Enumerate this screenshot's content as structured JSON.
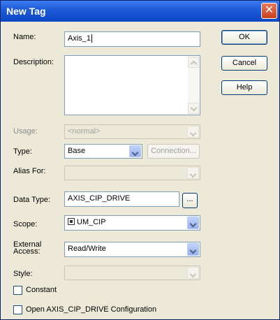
{
  "window": {
    "title": "New Tag",
    "close_glyph": "✕"
  },
  "labels": {
    "name": "Name:",
    "description": "Description:",
    "usage": "Usage:",
    "type": "Type:",
    "alias_for": "Alias For:",
    "data_type": "Data Type:",
    "scope": "Scope:",
    "external_access_line1": "External",
    "external_access_line2": "Access:",
    "style": "Style:"
  },
  "fields": {
    "name_value": "Axis_1",
    "description_value": "",
    "usage_value": "<normal>",
    "type_value": "Base",
    "alias_for_value": "",
    "data_type_value": "AXIS_CIP_DRIVE",
    "scope_value": "UM_CIP",
    "external_access_value": "Read/Write",
    "style_value": ""
  },
  "buttons": {
    "ok": "OK",
    "cancel": "Cancel",
    "help": "Help",
    "connection": "Connection...",
    "ellipsis": "..."
  },
  "checkboxes": {
    "constant": {
      "label": "Constant",
      "checked": false
    },
    "open_config": {
      "label": "Open AXIS_CIP_DRIVE Configuration",
      "checked": false
    }
  },
  "icons": {
    "close": "close-icon",
    "scope": "controller-icon",
    "dropdown": "chevron-down-icon",
    "scroll_up": "scroll-up-arrow-icon",
    "scroll_down": "scroll-down-arrow-icon"
  },
  "colors": {
    "titlebar": "#1f5cd8",
    "close_button": "#c8411e",
    "dialog_bg": "#ece9d8",
    "field_border": "#7f9db9"
  }
}
